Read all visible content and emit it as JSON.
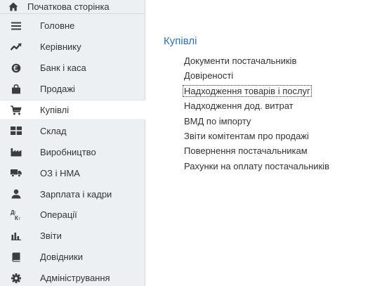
{
  "sidebar": {
    "home": {
      "label": "Початкова сторінка",
      "icon": "home-icon"
    },
    "items": [
      {
        "key": "main",
        "label": "Головне",
        "icon": "menu-lines-icon"
      },
      {
        "key": "manager",
        "label": "Керівнику",
        "icon": "trend-chart-icon"
      },
      {
        "key": "bank",
        "label": "Банк і каса",
        "icon": "coins-icon"
      },
      {
        "key": "sales",
        "label": "Продажі",
        "icon": "shopping-bag-icon"
      },
      {
        "key": "purchases",
        "label": "Купівлі",
        "icon": "shopping-cart-icon",
        "active": true
      },
      {
        "key": "warehouse",
        "label": "Склад",
        "icon": "warehouse-grid-icon"
      },
      {
        "key": "production",
        "label": "Виробництво",
        "icon": "factory-icon"
      },
      {
        "key": "assets",
        "label": "ОЗ і НМА",
        "icon": "truck-icon"
      },
      {
        "key": "salary",
        "label": "Зарплата і кадри",
        "icon": "person-icon"
      },
      {
        "key": "operations",
        "label": "Операції",
        "icon": "dt-kt-icon"
      },
      {
        "key": "reports",
        "label": "Звіти",
        "icon": "bar-chart-icon"
      },
      {
        "key": "references",
        "label": "Довідники",
        "icon": "book-icon"
      },
      {
        "key": "admin",
        "label": "Адміністрування",
        "icon": "gear-icon"
      }
    ]
  },
  "main": {
    "title": "Купівлі",
    "links": [
      {
        "label": "Документи постачальників"
      },
      {
        "label": "Довіреності"
      },
      {
        "label": "Надходження товарів і послуг",
        "focused": true
      },
      {
        "label": "Надходження дод. витрат"
      },
      {
        "label": "ВМД по імпорту"
      },
      {
        "label": "Звіти комітентам про продажі"
      },
      {
        "label": "Повернення постачальникам"
      },
      {
        "label": "Рахунки на оплату постачальників"
      }
    ]
  },
  "colors": {
    "sidebar_bg": "#edf0f2",
    "active_bg": "#ffffff",
    "title_blue": "#2b73b8",
    "text": "#333333",
    "icon": "#3d3d3d"
  }
}
